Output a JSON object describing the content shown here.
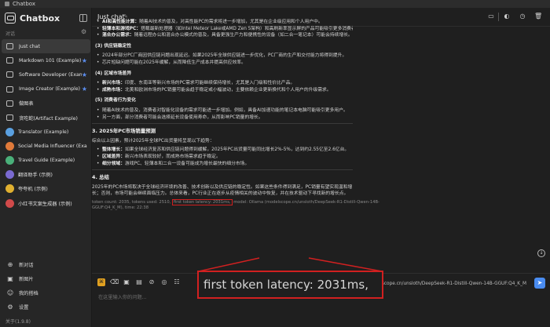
{
  "window": {
    "title": "Chatbox"
  },
  "sidebar": {
    "brand": "Chatbox",
    "section_label": "对话",
    "items": [
      {
        "label": "Just chat",
        "icon": "chat-bubble-icon",
        "active": true,
        "starred": false
      },
      {
        "label": "Markdown 101 (Example)",
        "icon": "chat-bubble-icon",
        "starred": true
      },
      {
        "label": "Software Developer (Example)",
        "icon": "chat-bubble-icon",
        "starred": true
      },
      {
        "label": "Image Creator (Example)",
        "icon": "chat-bubble-icon",
        "starred": true
      },
      {
        "label": "做图表",
        "icon": "chat-bubble-icon",
        "starred": false
      },
      {
        "label": "贪吃蛇(Artifact Example)",
        "icon": "chat-bubble-icon",
        "starred": false
      },
      {
        "label": "Translator (Example)",
        "icon": "avatar-icon",
        "avatar_color": "#5aa0e0",
        "starred": false
      },
      {
        "label": "Social Media Influencer (Example)",
        "icon": "avatar-icon",
        "avatar_color": "#e07a3a",
        "starred": false
      },
      {
        "label": "Travel Guide (Example)",
        "icon": "avatar-icon",
        "avatar_color": "#4ab07a",
        "starred": false
      },
      {
        "label": "翻译助手 (示例)",
        "icon": "avatar-icon",
        "avatar_color": "#7a6ad0",
        "starred": false
      },
      {
        "label": "夸夸机 (示例)",
        "icon": "avatar-icon",
        "avatar_color": "#e0b030",
        "starred": false
      },
      {
        "label": "小红书文案生成器 (示例)",
        "icon": "avatar-icon",
        "avatar_color": "#d04a4a",
        "starred": false
      }
    ],
    "bottom": [
      {
        "label": "新对话",
        "icon": "plus-icon"
      },
      {
        "label": "新图片",
        "icon": "image-icon"
      },
      {
        "label": "我的搭档",
        "icon": "user-icon"
      },
      {
        "label": "设置",
        "icon": "gear-icon"
      }
    ],
    "version": "关于(1.9.8)"
  },
  "header": {
    "title": "Just chat"
  },
  "message": {
    "top_bullets": [
      {
        "bold": "AI和高性能计算：",
        "text": "随着AI技术的普及，对高性能PC的需求将进一步增加，尤其是在企业级应用和个人用户中。"
      },
      {
        "bold": "轻薄本和游戏PC：",
        "text": "搭载最新处理器（如Intel Meteor Lake或AMD Zen 5架构）和高刷新率显示屏的产品可能吸引更多消费者。"
      },
      {
        "bold": "混合办公需求：",
        "text": "随着远程办公和混合办公模式的普及，具备更强生产力和便携性的设备（如二合一笔记本）可能会持续增长。"
      }
    ],
    "sec3_title": "(3) 供应链稳定性",
    "sec3_lines": [
      "2024年部分PC厂商因供应链问题出现延迟。如果2025年全球供应链进一步优化，PC厂商的生产和交付能力将得到提升。",
      "芯片短缺问题可能在2025年缓解，从而降低生产成本并提高供应效率。"
    ],
    "sec4_title": "(4) 区域市场差异",
    "sec4_bullets": [
      {
        "bold": "新兴市场：",
        "text": "印度、东南亚等新兴市场的PC需求可能继续保持增长，尤其是入门级和性价比产品。"
      },
      {
        "bold": "成熟市场：",
        "text": "北美和欧洲市场的PC销量可能会趋于稳定或小幅波动，主要依赖企业更新换代和个人用户的升级需求。"
      }
    ],
    "sec5_title": "(5) 消费者行为变化",
    "sec5_bullets": [
      "随着AI技术的普及，消费者对智能化设备的需求可能进一步增加。例如，具备AI加速功能的笔记本电脑可能吸引更多用户。",
      "另一方面，部分消费者可能会选择延长设备使用寿命，从而影响PC销量的增长。"
    ],
    "forecast_title": "3. 2025年PC市场销量预测",
    "forecast_intro": "综合以上因素，预计2025年全球PC出货量将呈现以下趋势：",
    "forecast_bullets": [
      {
        "bold": "整体增长：",
        "text": "如果全球经济复苏和供应链问题得到缓解，2025年PC出货量可能同比增长2%-5%，达到约2.55亿至2.6亿台。"
      },
      {
        "bold": "区域差异：",
        "text": "新兴市场表现较好，而成熟市场需求趋于稳定。"
      },
      {
        "bold": "细分领域：",
        "text": "游戏PC、轻薄本和二合一设备可能成为增长最快的细分市场。"
      }
    ],
    "summary_title": "4. 总结",
    "summary_lines": [
      "2025年的PC市场将取决于全球经济环境的改善、技术创新以及供应链的稳定性。如果这些条件得到满足，PC销量有望实现温和增",
      "长；否则，市场可能会继续面临压力。总体来看，PC行业正在逐步从疫情相关的波动中恢复，并在技术驱动下寻找新的增长点。"
    ],
    "meta_prefix": "token count: 2035, tokens used: 2510, ",
    "meta_highlight": "first token latency: 2031ms,",
    "meta_suffix_1": " model: Ollama (modelscope.cn/unsloth/DeepSeek-R1-Distill-Qwen-14B-",
    "meta_suffix_2": "GGUF:Q4_K_M), time: 22:38"
  },
  "input": {
    "placeholder": "在这里输入你的问题...",
    "model": "modelscope.cn/unsloth/DeepSeek-R1-Distill-Qwen-14B-GGUF:Q4_K_M"
  },
  "zoom_callout": {
    "text": "first token latency: 2031ms,",
    "color": "#d12020"
  }
}
